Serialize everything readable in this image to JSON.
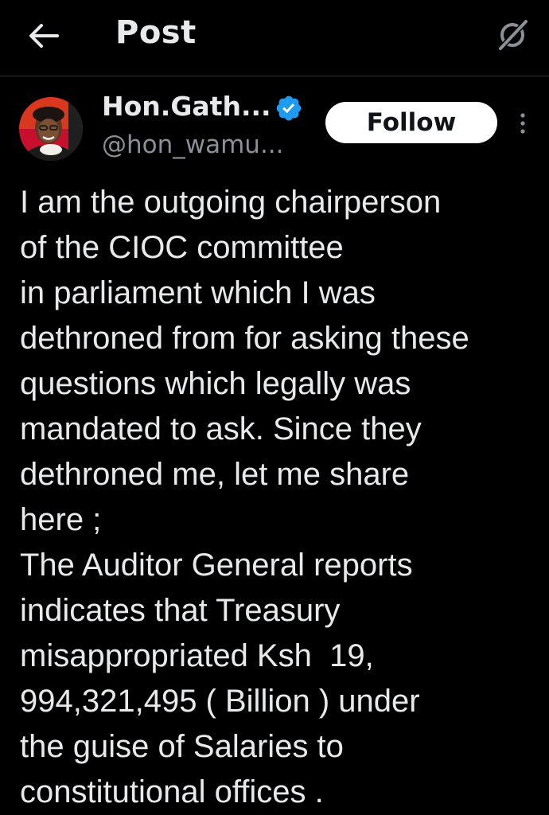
{
  "header": {
    "title": "Post",
    "back_icon": "arrow-left-icon",
    "grok_icon": "grok-icon"
  },
  "author": {
    "name": "Hon.Gath...",
    "handle": "@hon_wamu...",
    "verified": true,
    "verified_icon": "verified-badge-icon",
    "verified_color": "#1d9bf0"
  },
  "actions": {
    "follow_label": "Follow",
    "more_icon": "more-vertical-icon"
  },
  "post": {
    "lines": [
      "I am the outgoing chairperson",
      "of the CIOC committee",
      "in parliament which I was",
      "dethroned from for asking these",
      "questions which legally was",
      "mandated to ask. Since they",
      "dethroned me, let me share",
      "here ;",
      "The Auditor General reports",
      "indicates that Treasury",
      "misappropriated Ksh  19,",
      "994,321,495 ( Billion ) under",
      "the guise of Salaries to",
      "constitutional offices ."
    ]
  },
  "colors": {
    "background": "#000000",
    "text_primary": "#e7e9ea",
    "text_secondary": "#8b9096",
    "divider": "#2f3336",
    "accent": "#1d9bf0"
  }
}
